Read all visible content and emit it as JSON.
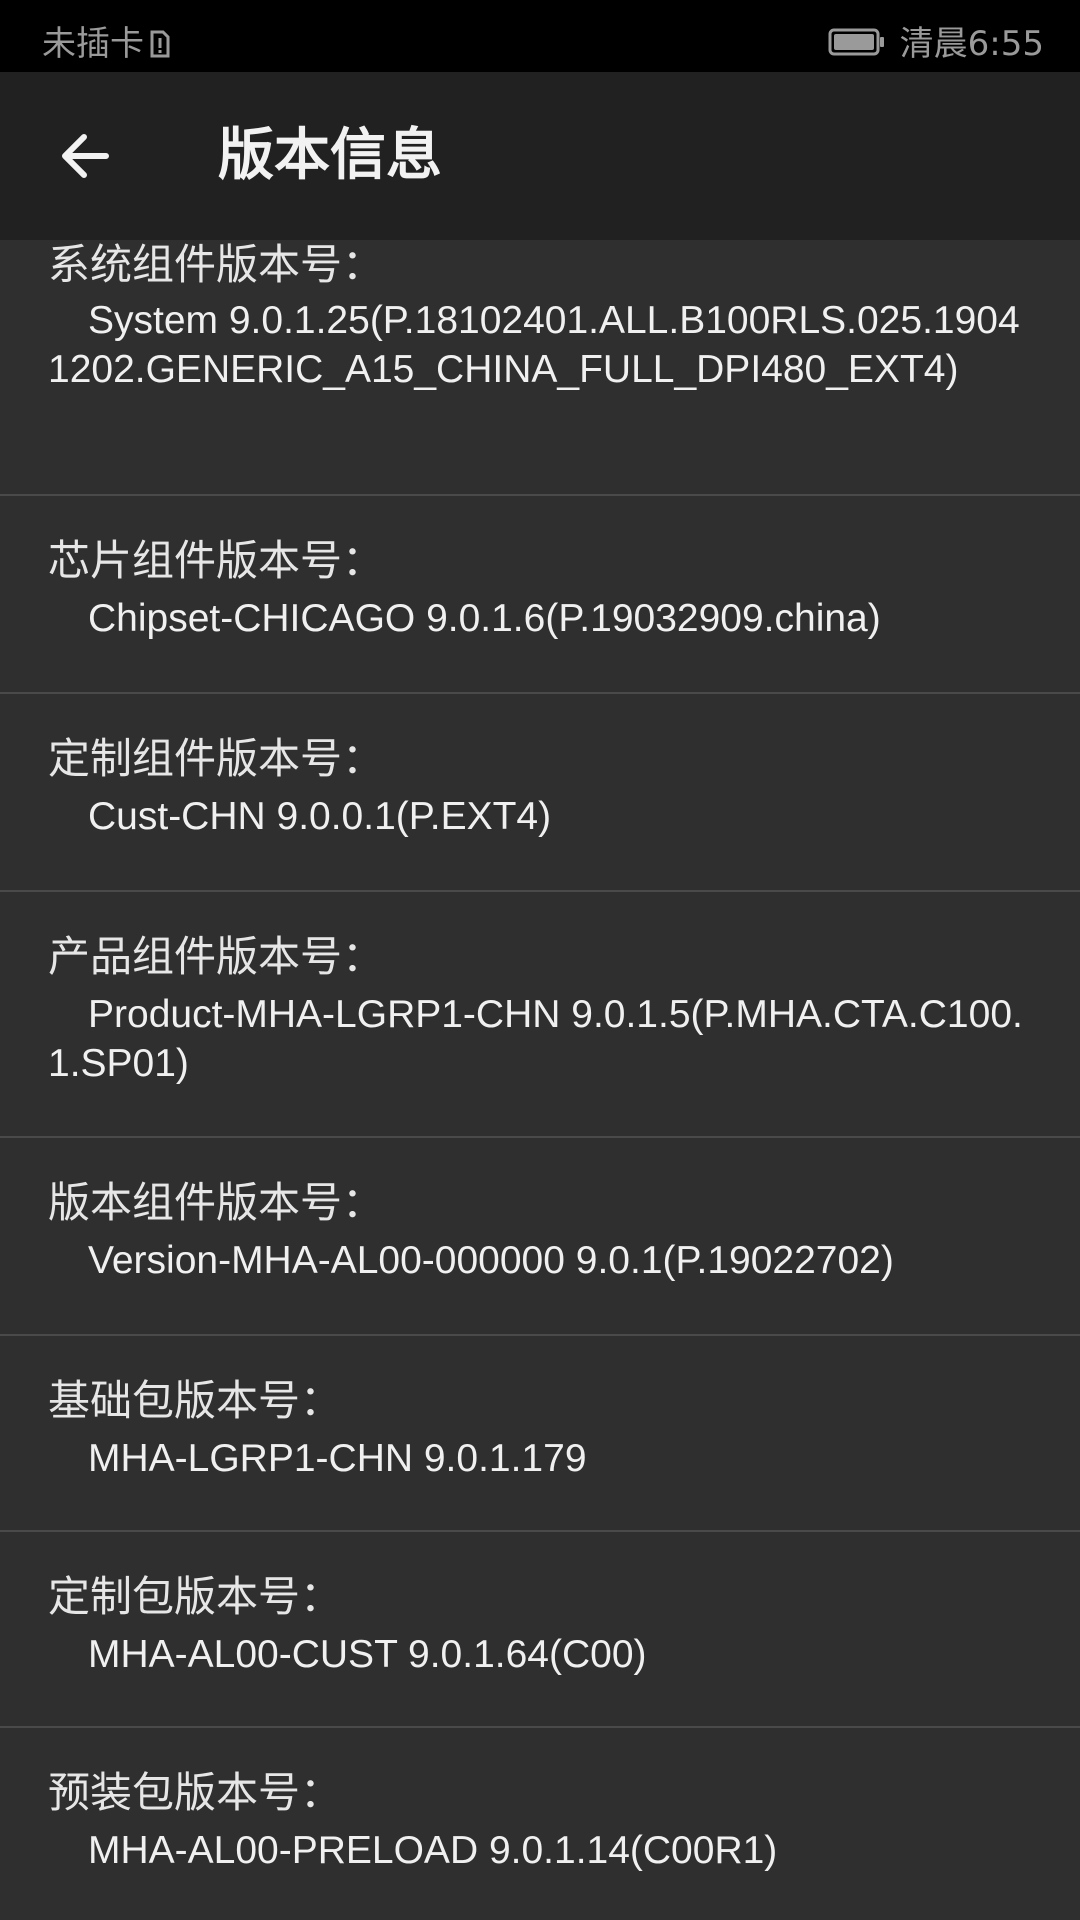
{
  "status_bar": {
    "carrier": "未插卡",
    "time": "清晨6:55",
    "icons": [
      "sim-missing-icon",
      "battery-icon"
    ]
  },
  "app_bar": {
    "back_icon": "arrow-left-icon",
    "title": "版本信息"
  },
  "items": [
    {
      "label": "系统组件版本号：",
      "value": "System 9.0.1.25(P.18102401.ALL.B100RLS.025.19041202.GENERIC_A15_CHINA_FULL_DPI480_EXT4)"
    },
    {
      "label": "芯片组件版本号：",
      "value": "Chipset-CHICAGO 9.0.1.6(P.19032909.china)"
    },
    {
      "label": "定制组件版本号：",
      "value": "Cust-CHN 9.0.0.1(P.EXT4)"
    },
    {
      "label": "产品组件版本号：",
      "value": "Product-MHA-LGRP1-CHN 9.0.1.5(P.MHA.CTA.C100.1.SP01)"
    },
    {
      "label": "版本组件版本号：",
      "value": "Version-MHA-AL00-000000 9.0.1(P.19022702)"
    },
    {
      "label": "基础包版本号：",
      "value": "MHA-LGRP1-CHN 9.0.1.179"
    },
    {
      "label": "定制包版本号：",
      "value": "MHA-AL00-CUST 9.0.1.64(C00)"
    },
    {
      "label": "预装包版本号：",
      "value": "MHA-AL00-PRELOAD 9.0.1.14(C00R1)"
    }
  ],
  "colors": {
    "status_bar_bg": "#000000",
    "app_bar_bg": "#212121",
    "content_bg": "#2f2f2f",
    "divider": "#4a4a4a",
    "text": "#f0f0f0"
  }
}
